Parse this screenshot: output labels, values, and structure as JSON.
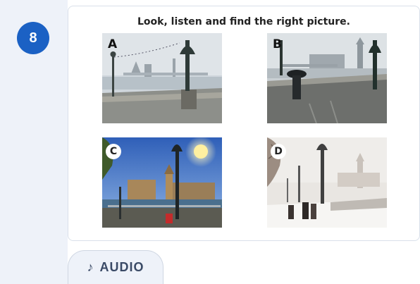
{
  "question": {
    "number": "8",
    "instruction": "Look, listen and find the right picture."
  },
  "options": [
    {
      "letter": "A",
      "scene": "river embankment with lamp post, misty morning"
    },
    {
      "letter": "B",
      "scene": "rainy riverside walk with umbrella"
    },
    {
      "letter": "C",
      "scene": "sunny river view with clock tower"
    },
    {
      "letter": "D",
      "scene": "snowy riverside path with lamp posts"
    }
  ],
  "audio_button": {
    "icon": "music-note-icon",
    "label": "AUDIO"
  },
  "colors": {
    "badge": "#1b61c4",
    "rail": "#eef2f9",
    "audio_text": "#3a4a66"
  }
}
